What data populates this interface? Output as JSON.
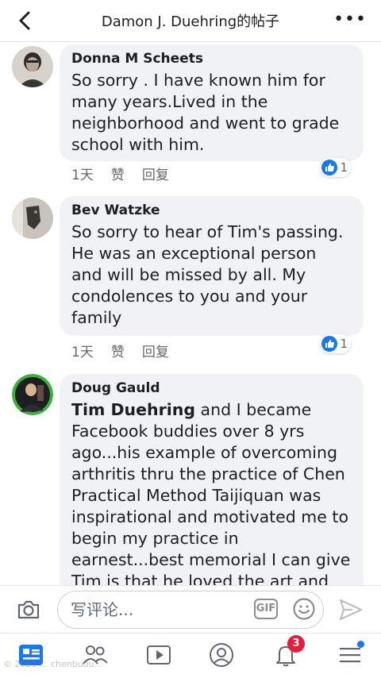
{
  "header": {
    "title": "Damon J. Duehring的帖子"
  },
  "comments": [
    {
      "author": "Donna M Scheets",
      "text": "So sorry . I have known him for many years.Lived in the neighborhood and went to grade school with him.",
      "time": "1天",
      "like_label": "赞",
      "reply_label": "回复",
      "reaction_count": "1"
    },
    {
      "author": "Bev Watzke",
      "text": "So sorry to hear of Tim's passing. He was an exceptional person and will be missed  by all.  My condolences to you and your family",
      "time": "1天",
      "like_label": "赞",
      "reply_label": "回复",
      "reaction_count": "1"
    },
    {
      "author": "Doug Gauld",
      "mention": "Tim Duehring",
      "text": " and I became Facebook buddies over 8 yrs ago...his example of overcoming arthritis thru the practice of Chen Practical Method Taijiquan was inspirational and motivated me to begin my practice in earnest...best memorial I can give Tim is that he loved the art and brought his heart"
    }
  ],
  "composer": {
    "placeholder": "写评论...",
    "gif_label": "GIF"
  },
  "tabbar": {
    "notification_count": "3"
  },
  "watermark": "© 2021 ... chenbudu..."
}
